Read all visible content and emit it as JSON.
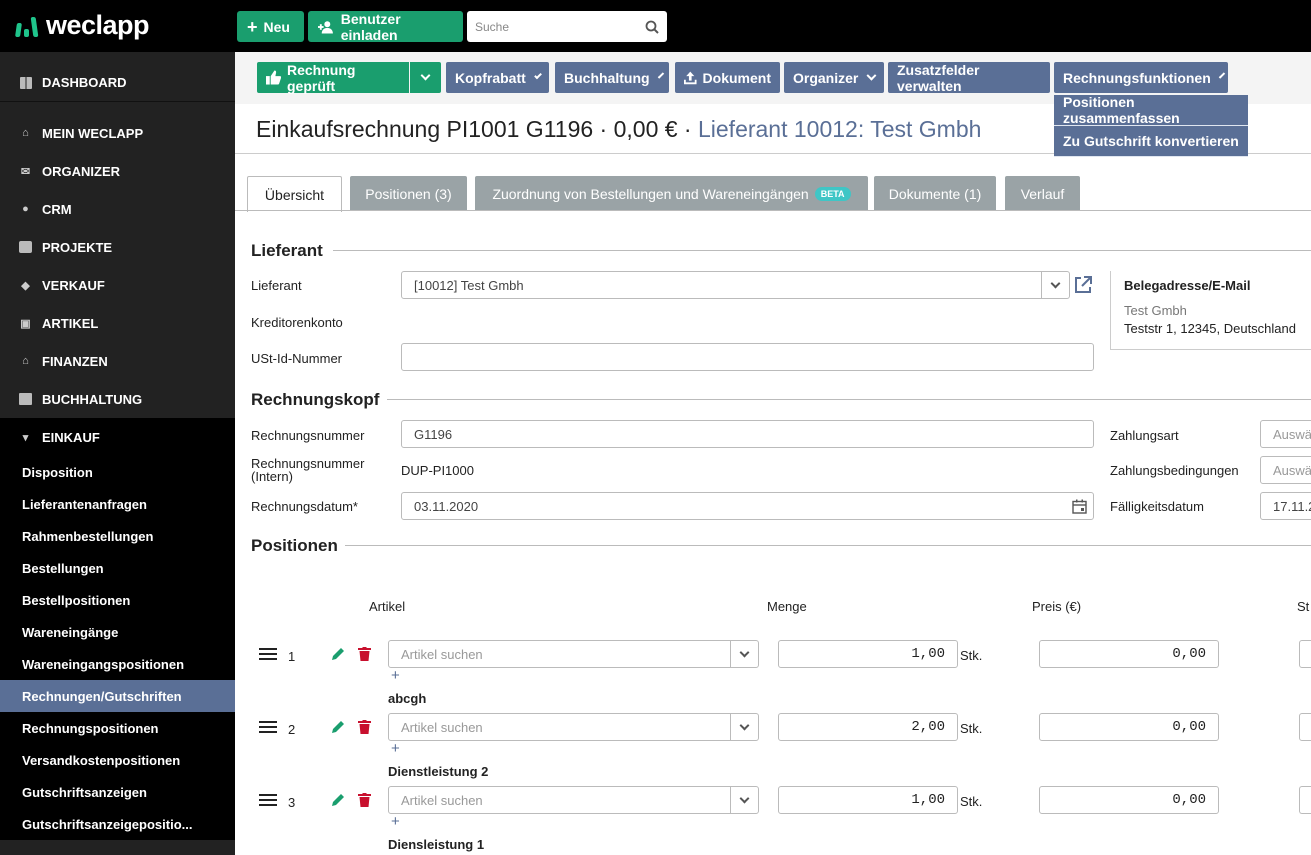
{
  "topbar": {
    "logo": "weclapp",
    "new_label": "Neu",
    "invite_label": "Benutzer einladen",
    "search_placeholder": "Suche"
  },
  "sidebar": {
    "items": [
      {
        "label": "DASHBOARD",
        "icon": "dashboard-icon"
      },
      {
        "label": "MEIN WECLAPP",
        "icon": "home-icon"
      },
      {
        "label": "ORGANIZER",
        "icon": "mail-icon"
      },
      {
        "label": "CRM",
        "icon": "users-icon"
      },
      {
        "label": "PROJEKTE",
        "icon": "briefcase-icon"
      },
      {
        "label": "VERKAUF",
        "icon": "tag-icon"
      },
      {
        "label": "ARTIKEL",
        "icon": "box-icon"
      },
      {
        "label": "FINANZEN",
        "icon": "bank-icon"
      },
      {
        "label": "BUCHHALTUNG",
        "icon": "calculator-icon"
      },
      {
        "label": "EINKAUF",
        "icon": "cart-icon"
      }
    ],
    "sub_items": [
      "Disposition",
      "Lieferantenanfragen",
      "Rahmenbestellungen",
      "Bestellungen",
      "Bestellpositionen",
      "Wareneingänge",
      "Wareneingangspositionen",
      "Rechnungen/Gutschriften",
      "Rechnungspositionen",
      "Versandkostenpositionen",
      "Gutschriftsanzeigen",
      "Gutschriftsanzeigepositio..."
    ],
    "active_sub": "Rechnungen/Gutschriften"
  },
  "toolbar": {
    "checked": "Rechnung geprüft",
    "discount": "Kopfrabatt",
    "accounting": "Buchhaltung",
    "document": "Dokument",
    "organizer": "Organizer",
    "extra_fields": "Zusatzfelder verwalten",
    "invoice_functions": "Rechnungsfunktionen",
    "dropdown": [
      "Positionen zusammenfassen",
      "Zu Gutschrift konvertieren"
    ]
  },
  "title": {
    "main": "Einkaufsrechnung PI1001 G1196 · 0,00 € · ",
    "link": "Lieferant 10012: Test Gmbh"
  },
  "tabs": [
    {
      "label": "Übersicht",
      "active": true
    },
    {
      "label": "Positionen (3)"
    },
    {
      "label": "Zuordnung von Bestellungen und Wareneingängen",
      "badge": "BETA"
    },
    {
      "label": "Dokumente (1)"
    },
    {
      "label": "Verlauf"
    }
  ],
  "supplier": {
    "heading": "Lieferant",
    "supplier_label": "Lieferant",
    "supplier_value": "[10012] Test Gmbh",
    "creditor_label": "Kreditorenkonto",
    "vat_label": "USt-Id-Nummer",
    "vat_value": "",
    "address_heading": "Belegadresse/E-Mail",
    "address_name": "Test Gmbh",
    "address_street": "Teststr 1, 12345, Deutschland"
  },
  "invoice_head": {
    "heading": "Rechnungskopf",
    "number_label": "Rechnungsnummer",
    "number_value": "G1196",
    "internal_label_1": "Rechnungsnummer",
    "internal_label_2": "(Intern)",
    "internal_value": "DUP-PI1000",
    "date_label": "Rechnungsdatum*",
    "date_value": "03.11.2020",
    "payment_method_label": "Zahlungsart",
    "payment_method_placeholder": "Auswä",
    "payment_terms_label": "Zahlungsbedingungen",
    "payment_terms_placeholder": "Auswä",
    "due_date_label": "Fälligkeitsdatum",
    "due_date_value": "17.11.20"
  },
  "positions": {
    "heading": "Positionen",
    "col_article": "Artikel",
    "col_quantity": "Menge",
    "col_price": "Preis (€)",
    "col_tax": "St",
    "article_placeholder": "Artikel suchen",
    "unit": "Stk.",
    "rows": [
      {
        "index": "1",
        "quantity": "1,00",
        "price": "0,00",
        "name": "abcgh"
      },
      {
        "index": "2",
        "quantity": "2,00",
        "price": "0,00",
        "name": "Dienstleistung 2"
      },
      {
        "index": "3",
        "quantity": "1,00",
        "price": "0,00",
        "name": "Diensleistung 1"
      }
    ]
  },
  "colors": {
    "accent_green": "#1a9e6e",
    "accent_blue": "#5a6f96",
    "sidebar_bg": "#222222",
    "delete_red": "#c8102e"
  }
}
